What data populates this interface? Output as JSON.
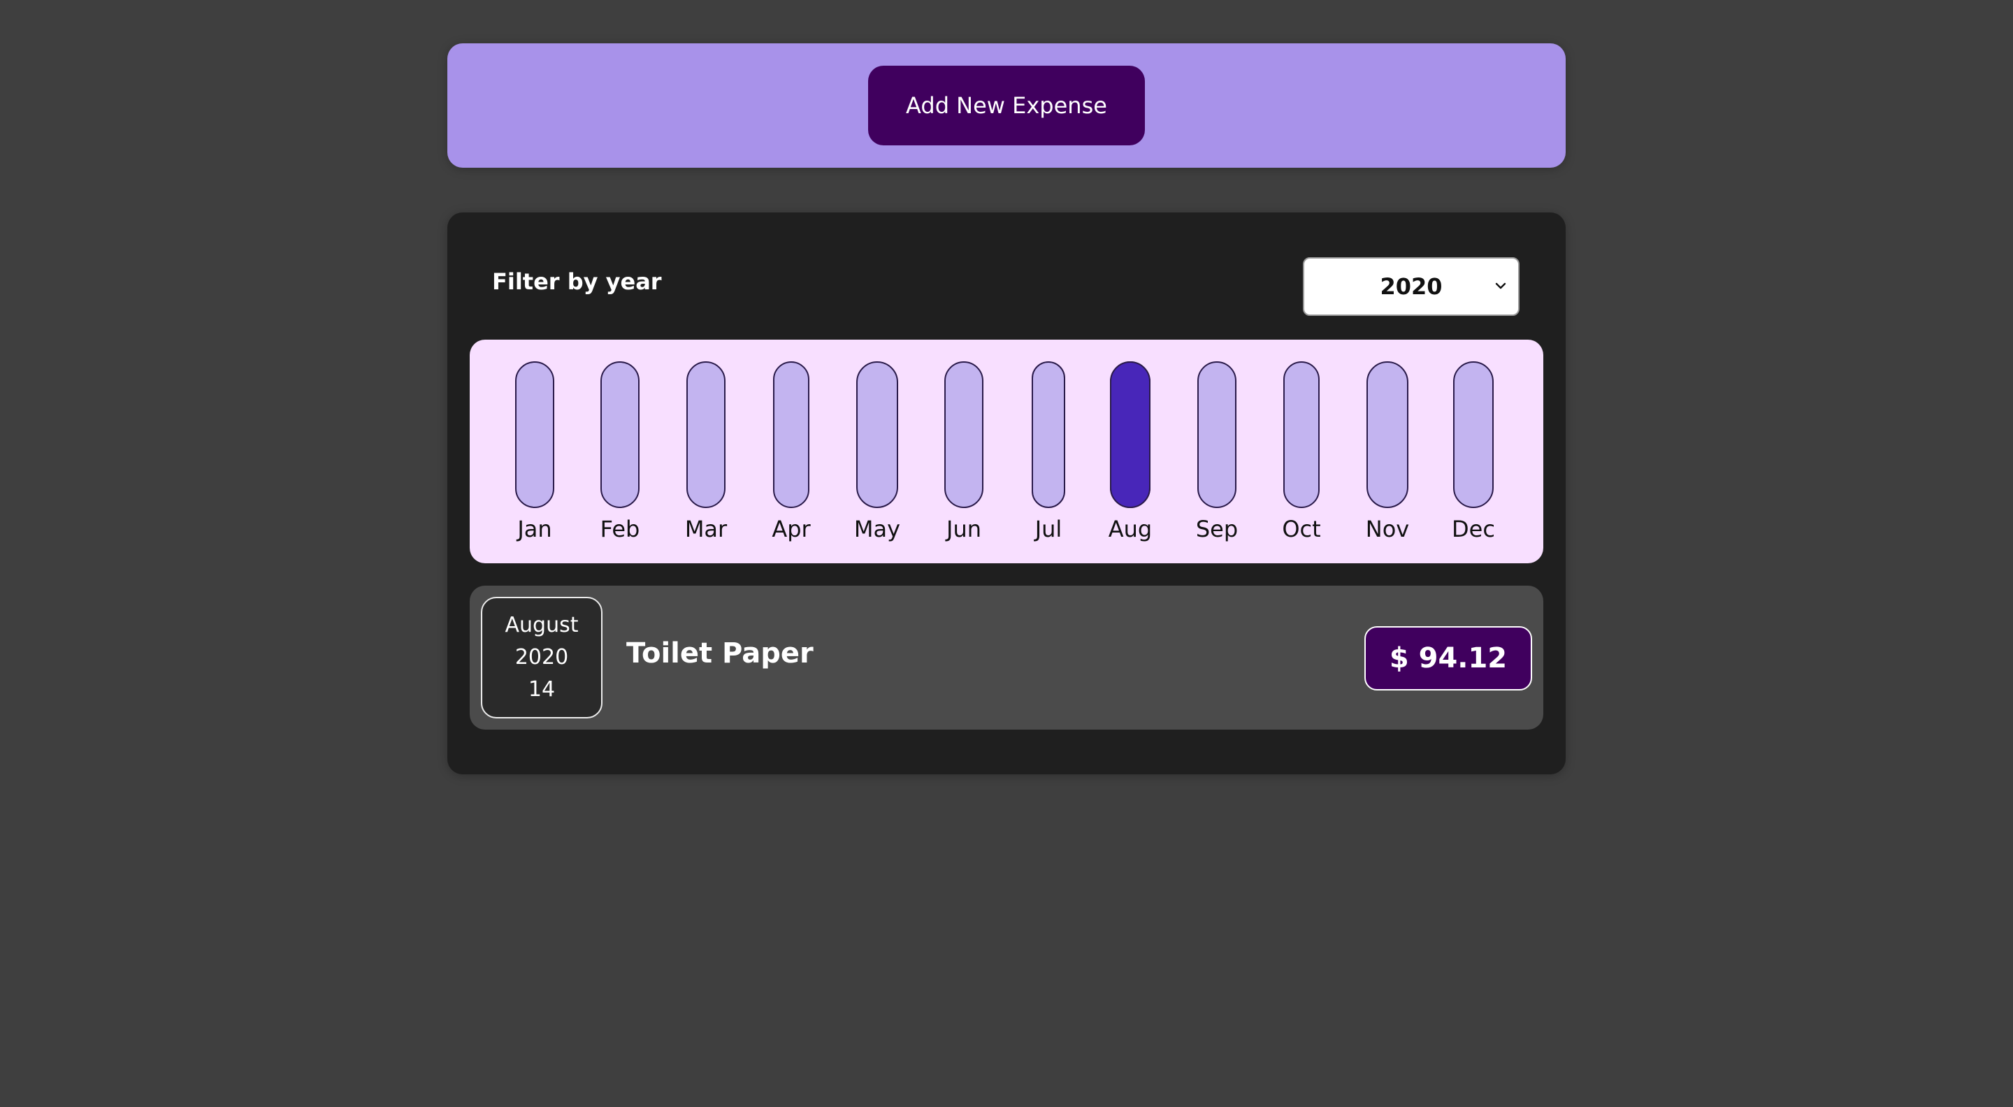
{
  "new_expense": {
    "button_label": "Add New Expense"
  },
  "filter": {
    "label": "Filter by year",
    "selected_year": "2020"
  },
  "chart_data": {
    "type": "bar",
    "categories": [
      "Jan",
      "Feb",
      "Mar",
      "Apr",
      "May",
      "Jun",
      "Jul",
      "Aug",
      "Sep",
      "Oct",
      "Nov",
      "Dec"
    ],
    "values": [
      0,
      0,
      0,
      0,
      0,
      0,
      0,
      94.12,
      0,
      0,
      0,
      0
    ],
    "max_value": 94.12,
    "title": "",
    "xlabel": "",
    "ylabel": "",
    "colors": {
      "track": "#c3b4f0",
      "fill": "#4826b9",
      "border": "#2a1a4a",
      "label": "#111111"
    }
  },
  "expenses": [
    {
      "month": "August",
      "year": "2020",
      "day": "14",
      "title": "Toilet Paper",
      "amount": "$ 94.12"
    }
  ],
  "colors": {
    "page_bg": "#3f3f3f",
    "new_expense_bg": "#a892ea",
    "button_bg": "#40005e",
    "card_bg": "#1f1f1f",
    "chart_bg": "#f8dfff",
    "item_bg": "#4b4b4b"
  }
}
